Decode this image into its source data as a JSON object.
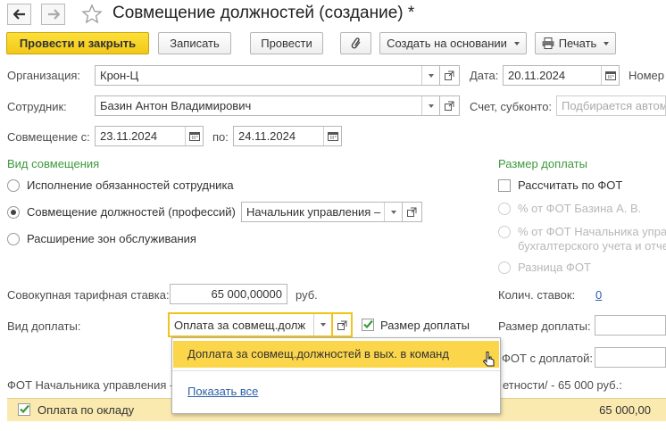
{
  "window": {
    "title": "Совмещение должностей (создание) *"
  },
  "toolbar": {
    "post_close": "Провести и закрыть",
    "save": "Записать",
    "post": "Провести",
    "create_based": "Создать на основании",
    "print": "Печать"
  },
  "form": {
    "organization_label": "Организация:",
    "organization_value": "Крон-Ц",
    "date_label": "Дата:",
    "date_value": "20.11.2024",
    "number_label": "Номер",
    "employee_label": "Сотрудник:",
    "employee_value": "Базин Антон Владимирович",
    "account_label": "Счет, субконто:",
    "account_placeholder": "Подбирается автом",
    "from_label": "Совмещение с:",
    "from_value": "23.11.2024",
    "to_label": "по:",
    "to_value": "24.11.2024"
  },
  "combination": {
    "section_title": "Вид совмещения",
    "options": [
      {
        "label": "Исполнение обязанностей сотрудника",
        "selected": false
      },
      {
        "label": "Совмещение должностей (профессий)",
        "selected": true
      },
      {
        "label": "Расширение зон обслуживания",
        "selected": false
      }
    ],
    "position_value": "Начальник управления –"
  },
  "surcharge_size": {
    "section_title": "Размер доплаты",
    "calc_by_fot": "Рассчитать по ФОТ",
    "pct_fot_employee": "% от ФОТ Базина А. В.",
    "pct_fot_head_1": "% от ФОТ Начальника упра",
    "pct_fot_head_2": "бухгалтерского учета и отче",
    "diff_fot": "Разница ФОТ",
    "rates_count_label": "Колич. ставок:",
    "rates_count_value": "0",
    "amount_label": "Размер доплаты:",
    "fot_with_label": "ФОТ с доплатой:"
  },
  "rate": {
    "label": "Совокупная тарифная ставка:",
    "value": "65 000,00000",
    "unit": "руб."
  },
  "surcharge_type": {
    "label": "Вид доплаты:",
    "value": "Оплата за совмещ.долж",
    "size_checkbox_label": "Размер доплаты",
    "size_checked": true
  },
  "dropdown": {
    "item": "Доплата за совмещ.должностей в вых. в команд",
    "show_all": "Показать все"
  },
  "fot_section": {
    "label_left": "ФОТ Начальника управления -",
    "label_right": "етности/ - 65 000 руб.:",
    "row_label": "Оплата по окладу",
    "row_value": "65 000,00",
    "row_checked": true
  },
  "colors": {
    "primary_button": "#f5cc1f",
    "section_title": "#3c9a3c",
    "dropdown_highlight": "#fbd54a",
    "table_row": "#fbeab0",
    "link": "#2b5fa8"
  }
}
